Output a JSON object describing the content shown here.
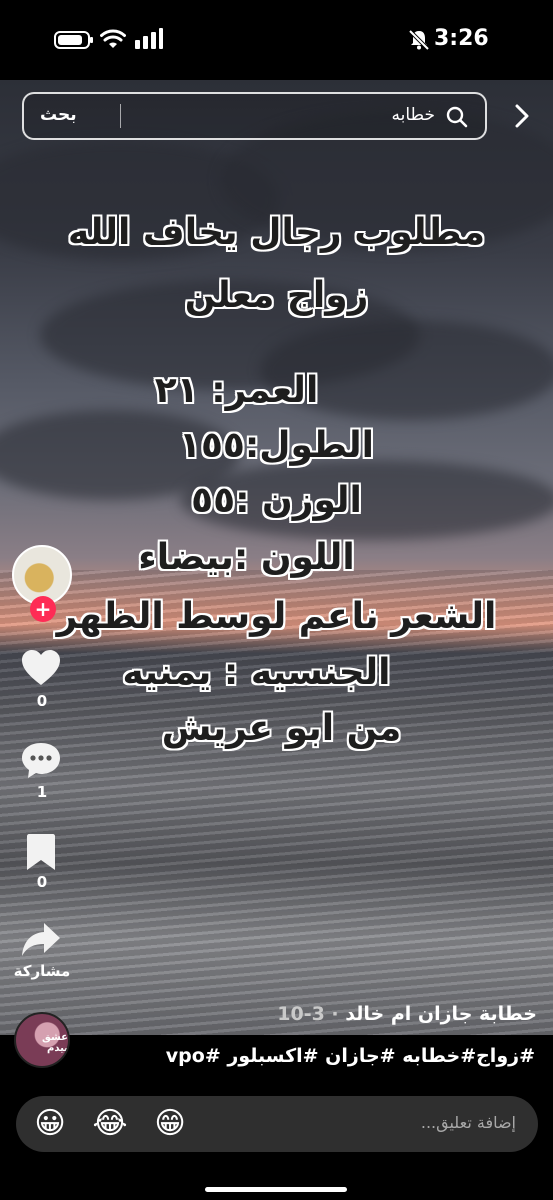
{
  "status_bar": {
    "time": "3:26",
    "battery_level": 0.85,
    "icons": [
      "battery-icon",
      "wifi-icon",
      "signal-icon",
      "mute-bell-icon"
    ]
  },
  "search": {
    "value": "خطابه",
    "action_label": "بحث"
  },
  "video_text": {
    "line1": "مطلوب رجال يخاف الله",
    "line2": "زواج معلن",
    "age": "العمر:  ٢١",
    "height": "الطول:١٥٥",
    "weight": "الوزن :٥٥",
    "color": "اللون :بيضاء",
    "hair": "الشعر ناعم  لوسط الظهر",
    "nationality": "الجنسيه : يمنيه",
    "origin": "من ابو عريش"
  },
  "actions": {
    "likes": "0",
    "comments": "1",
    "saves": "0",
    "share_label": "مشاركة"
  },
  "caption": {
    "author": "خطابة جازان ام خالد",
    "date": "3-10",
    "hashtags": "#زواج#خطابه #جازان #اكسبلور #vpo",
    "author_avatar_text": "عشق بيدم"
  },
  "comment": {
    "placeholder": "إضافة تعليق...",
    "emojis": [
      "😀",
      "😂",
      "😁"
    ]
  },
  "colors": {
    "follow_accent": "#fe2c55",
    "comment_bar": "#2f2f2f"
  }
}
